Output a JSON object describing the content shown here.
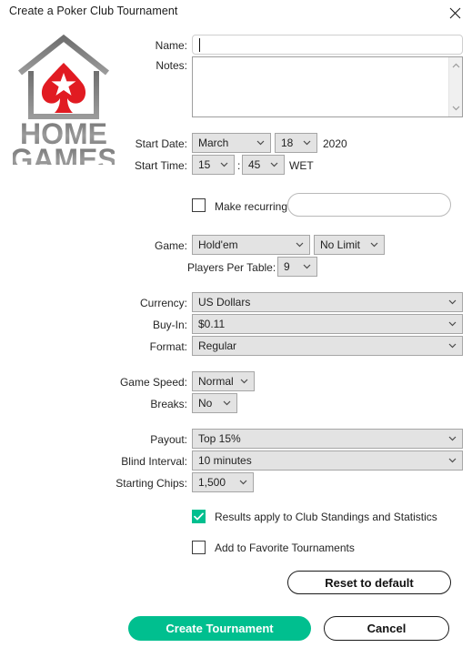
{
  "window": {
    "title": "Create a Poker Club Tournament",
    "close_icon": "close-icon"
  },
  "logo": {
    "line1": "HOME",
    "line2": "GAMES",
    "spade_color": "#e11b22",
    "house_color": "#8a8a8a",
    "text_color": "#8c8c8c"
  },
  "form": {
    "name": {
      "label": "Name:",
      "value": "",
      "placeholder": ""
    },
    "notes": {
      "label": "Notes:",
      "value": "",
      "placeholder": ""
    },
    "start_date": {
      "label": "Start Date:",
      "month": "March",
      "day": "18",
      "year": "2020"
    },
    "start_time": {
      "label": "Start Time:",
      "hour": "15",
      "separator": ":",
      "minute": "45",
      "timezone": "WET"
    },
    "make_recurring": {
      "label": "Make recurring",
      "checked": false
    },
    "game": {
      "label": "Game:",
      "variant": "Hold'em",
      "limit": "No Limit"
    },
    "players_per_table": {
      "label": "Players Per Table:",
      "value": "9"
    },
    "currency": {
      "label": "Currency:",
      "value": "US Dollars"
    },
    "buy_in": {
      "label": "Buy-In:",
      "value": "$0.11"
    },
    "format": {
      "label": "Format:",
      "value": "Regular"
    },
    "game_speed": {
      "label": "Game Speed:",
      "value": "Normal"
    },
    "breaks": {
      "label": "Breaks:",
      "value": "No"
    },
    "payout": {
      "label": "Payout:",
      "value": "Top 15%"
    },
    "blind_interval": {
      "label": "Blind Interval:",
      "value": "10 minutes"
    },
    "starting_chips": {
      "label": "Starting Chips:",
      "value": "1,500"
    },
    "results_apply": {
      "label": "Results apply to Club Standings and Statistics",
      "checked": true
    },
    "add_favorite": {
      "label": "Add to Favorite Tournaments",
      "checked": false
    }
  },
  "buttons": {
    "reset": "Reset to default",
    "create": "Create Tournament",
    "cancel": "Cancel"
  },
  "colors": {
    "accent": "#00bf8f",
    "field_bg": "#e3e3e3",
    "text": "#262626"
  }
}
